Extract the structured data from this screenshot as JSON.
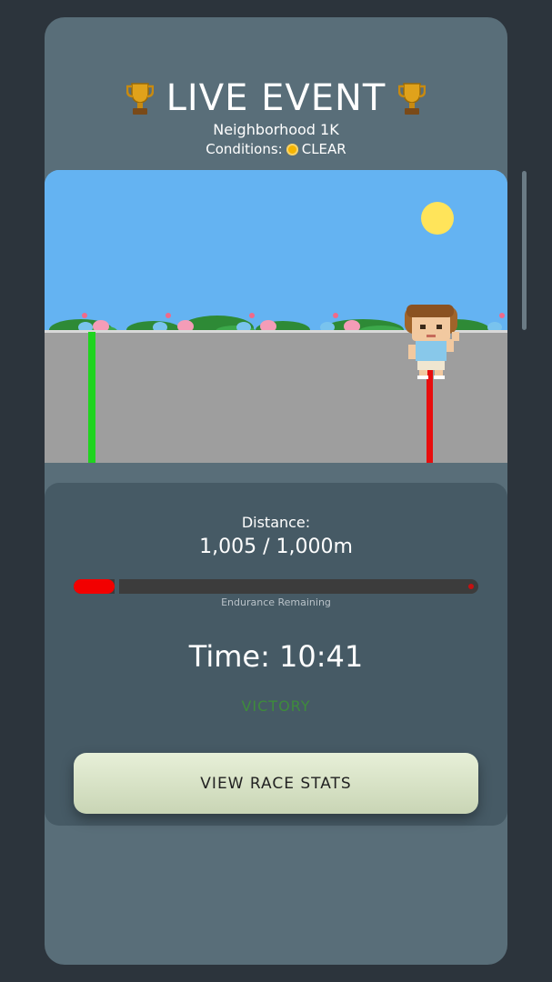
{
  "header": {
    "title": "LIVE EVENT",
    "event_name": "Neighborhood 1K",
    "conditions_label": "Conditions:",
    "conditions_value": "CLEAR"
  },
  "icons": {
    "title_left": "trophy-icon",
    "title_right": "trophy-icon",
    "weather": "sun-icon"
  },
  "race": {
    "distance_label": "Distance:",
    "distance_value": "1,005 / 1,000m",
    "endurance_label": "Endurance Remaining",
    "endurance_fraction": 0.1,
    "time_text": "Time: 10:41",
    "result_text": "VICTORY",
    "button_label": "VIEW RACE STATS"
  },
  "colors": {
    "sky": "#64b3f2",
    "track": "#9e9e9e",
    "start_line": "#1fd41f",
    "finish_line": "#e80d0d",
    "endurance_bar": "#f20000",
    "victory_text": "#3e8b3c"
  }
}
